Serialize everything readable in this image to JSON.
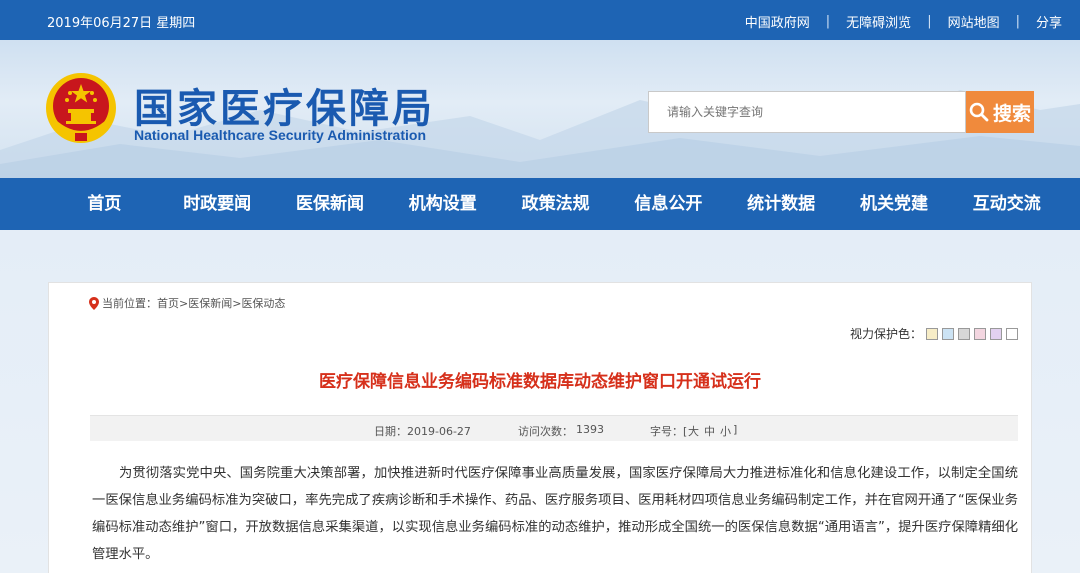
{
  "topbar": {
    "date": "2019年06月27日 星期四",
    "links": [
      "中国政府网",
      "无障碍浏览",
      "网站地图",
      "分享"
    ],
    "separator": "|"
  },
  "header": {
    "title_cn": "国家医疗保障局",
    "title_en": "National Healthcare Security Administration",
    "search_placeholder": "请输入关键字查询",
    "search_button": "搜索"
  },
  "nav": [
    "首页",
    "时政要闻",
    "医保新闻",
    "机构设置",
    "政策法规",
    "信息公开",
    "统计数据",
    "机关党建",
    "互动交流"
  ],
  "breadcrumb": {
    "prefix": "当前位置：",
    "items": [
      "首页",
      "医保新闻",
      "医保动态"
    ],
    "separator": ">"
  },
  "eye_care": {
    "label": "视力保护色：",
    "swatches": [
      "#f7edc7",
      "#cce3f4",
      "#d7d7d7",
      "#f3d6e0",
      "#e2d1f0",
      "#ffffff"
    ]
  },
  "article": {
    "title": "医疗保障信息业务编码标准数据库动态维护窗口开通试运行",
    "date_label": "日期：2019-06-27",
    "visits_label": "访问次数：",
    "visits": "1393",
    "font_label": "字号：[",
    "font_sizes": [
      "大",
      "中",
      "小"
    ],
    "font_label_end": "]",
    "body": "为贯彻落实党中央、国务院重大决策部署，加快推进新时代医疗保障事业高质量发展，国家医疗保障局大力推进标准化和信息化建设工作，以制定全国统一医保信息业务编码标准为突破口，率先完成了疾病诊断和手术操作、药品、医疗服务项目、医用耗材四项信息业务编码制定工作，并在官网开通了“医保业务编码标准动态维护”窗口，开放数据信息采集渠道，以实现信息业务编码标准的动态维护，推动形成全国统一的医保信息数据“通用语言”，提升医疗保障精细化管理水平。"
  },
  "colors": {
    "brand_blue": "#1e64b4",
    "search_orange": "#f08a3c",
    "headline_red": "#d6301b",
    "emblem_red": "#c8161d",
    "emblem_gold": "#f5c400"
  },
  "icons": [
    "national-emblem-icon",
    "search-icon",
    "location-pin-icon"
  ]
}
